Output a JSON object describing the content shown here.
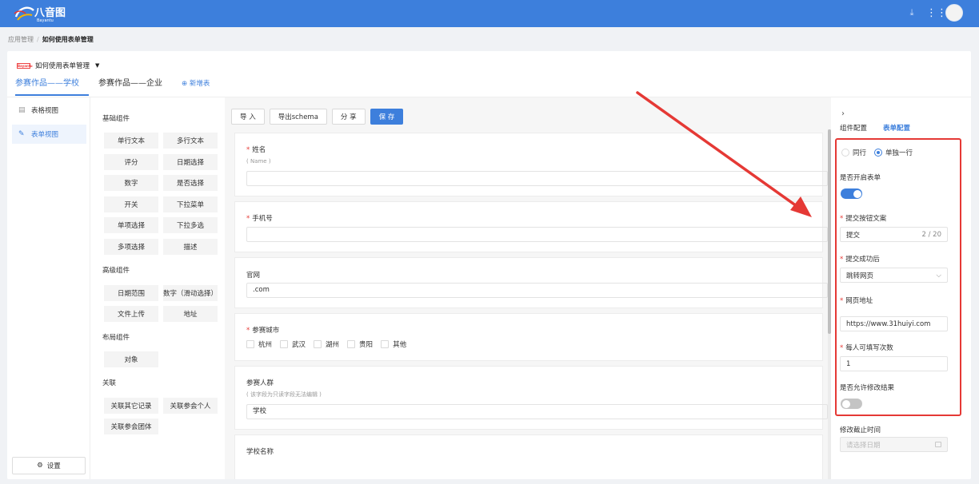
{
  "header": {
    "logo_text": "八音图",
    "logo_subtext": "Bayantu",
    "icons": [
      "download-icon",
      "apps-grid-icon",
      "user-avatar"
    ]
  },
  "breadcrumb": {
    "root": "应用管理",
    "current": "如何使用表单管理"
  },
  "app": {
    "logo_text": "Bayantu",
    "title": "如何使用表单管理"
  },
  "tabs": [
    {
      "label": "参赛作品——学校",
      "active": true
    },
    {
      "label": "参赛作品——企业",
      "active": false
    }
  ],
  "new_table_label": "新增表",
  "views": [
    {
      "label": "表格视图",
      "icon": "table-icon",
      "active": false
    },
    {
      "label": "表单视图",
      "icon": "form-edit-icon",
      "active": true
    }
  ],
  "settings_label": "设置",
  "palette": {
    "groups": [
      {
        "title": "基础组件",
        "items": [
          "单行文本",
          "多行文本",
          "评分",
          "日期选择",
          "数字",
          "是否选择",
          "开关",
          "下拉菜单",
          "单项选择",
          "下拉多选",
          "多项选择",
          "描述"
        ]
      },
      {
        "title": "高级组件",
        "items": [
          "日期范围",
          "数字（滑动选择）",
          "文件上传",
          "地址"
        ]
      },
      {
        "title": "布局组件",
        "items": [
          "对象"
        ]
      },
      {
        "title": "关联",
        "items": [
          "关联其它记录",
          "关联参会个人",
          "关联参会团体"
        ]
      }
    ]
  },
  "toolbar": {
    "import_label": "导 入",
    "export_label": "导出schema",
    "share_label": "分 享",
    "save_label": "保 存"
  },
  "form_fields": {
    "name": {
      "label": "姓名",
      "required": true,
      "desc": "( Name )",
      "value": ""
    },
    "phone": {
      "label": "手机号",
      "required": true,
      "value": ""
    },
    "website": {
      "label": "官网",
      "required": false,
      "value": ".com"
    },
    "city": {
      "label": "参赛城市",
      "required": true,
      "options": [
        "杭州",
        "武汉",
        "湖州",
        "贵阳",
        "其他"
      ]
    },
    "audience": {
      "label": "参赛人群",
      "required": false,
      "desc": "( 该字段为只读字段无法编辑 )",
      "value": "学校"
    },
    "school": {
      "label": "学校名称",
      "required": false
    }
  },
  "right_panel": {
    "tabs": [
      {
        "label": "组件配置",
        "active": false
      },
      {
        "label": "表单配置",
        "active": true
      }
    ],
    "layout_options": [
      {
        "label": "同行",
        "selected": false
      },
      {
        "label": "单独一行",
        "selected": true
      }
    ],
    "enable_form": {
      "label": "是否开启表单",
      "on": true
    },
    "submit_text": {
      "label": "提交按钮文案",
      "required": true,
      "value": "提交",
      "count": "2 / 20"
    },
    "after_submit": {
      "label": "提交成功后",
      "required": true,
      "value": "跳转网页"
    },
    "url": {
      "label": "网页地址",
      "required": true,
      "value": "https://www.31huiyi.com"
    },
    "times_per_person": {
      "label": "每人可填写次数",
      "required": true,
      "value": "1"
    },
    "allow_modify": {
      "label": "是否允许修改结果",
      "on": false
    },
    "modify_deadline": {
      "label": "修改截止时间",
      "placeholder": "请选择日期"
    }
  },
  "colors": {
    "primary": "#3d7fdc",
    "header_bg": "#3d7fdc",
    "required": "#e53935",
    "annotation": "#e53935"
  }
}
